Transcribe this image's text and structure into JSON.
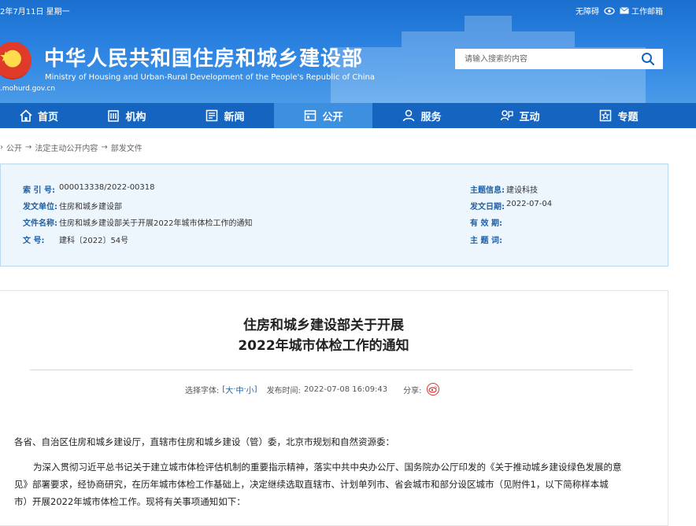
{
  "topbar": {
    "date": "2年7月11日 星期一",
    "accessibility": "无障碍",
    "mail": "工作邮箱"
  },
  "header": {
    "title": "中华人民共和国住房和城乡建设部",
    "subtitle": "Ministry of Housing and Urban-Rural Development of the People's Republic of China",
    "url": ".mohurd.gov.cn",
    "search_placeholder": "请输入搜索的内容"
  },
  "nav": [
    {
      "label": "首页",
      "icon": "home-icon"
    },
    {
      "label": "机构",
      "icon": "building-icon"
    },
    {
      "label": "新闻",
      "icon": "news-icon"
    },
    {
      "label": "公开",
      "icon": "open-icon",
      "active": true
    },
    {
      "label": "服务",
      "icon": "service-icon"
    },
    {
      "label": "互动",
      "icon": "interact-icon"
    },
    {
      "label": "专题",
      "icon": "topic-icon"
    }
  ],
  "breadcrumb": [
    "公开",
    "法定主动公开内容",
    "部发文件"
  ],
  "meta": {
    "index_label": "索 引 号:",
    "index_value": "000013338/2022-00318",
    "issuer_label": "发文单位:",
    "issuer_value": "住房和城乡建设部",
    "name_label": "文件名称:",
    "name_value": "住房和城乡建设部关于开展2022年城市体检工作的通知",
    "doc_no_label": "文 号:",
    "doc_no_value": "建科〔2022〕54号",
    "topic_label": "主题信息:",
    "topic_value": "建设科技",
    "date_label": "发文日期:",
    "date_value": "2022-07-04",
    "validity_label": "有 效 期:",
    "validity_value": "",
    "keywords_label": "主 题 词:",
    "keywords_value": ""
  },
  "article": {
    "title_line1": "住房和城乡建设部关于开展",
    "title_line2": "2022年城市体检工作的通知",
    "font_label": "选择字体:",
    "font_open": "[",
    "font_large": "大",
    "font_sep1": "·",
    "font_medium": "中",
    "font_sep2": "·",
    "font_small": "小",
    "font_close": "]",
    "publish_label": "发布时间:",
    "publish_value": "2022-07-08 16:09:43",
    "share_label": "分享:",
    "para1": "各省、自治区住房和城乡建设厅，直辖市住房和城乡建设（管）委，北京市规划和自然资源委：",
    "para2_l1": "为深入贯彻习近平总书记关于建立城市体检评估机制的重要指示精神，落实中共中央办公厅、国务院办公厅印发的《关于推动城乡建设绿色发展的意",
    "para2_l2": "见》部署要求，经协商研究，在历年城市体检工作基础上，决定继续选取直辖市、计划单列市、省会城市和部分设区城市（见附件1，以下简称样本城",
    "para2_l3": "市）开展2022年城市体检工作。现将有关事项通知如下："
  }
}
